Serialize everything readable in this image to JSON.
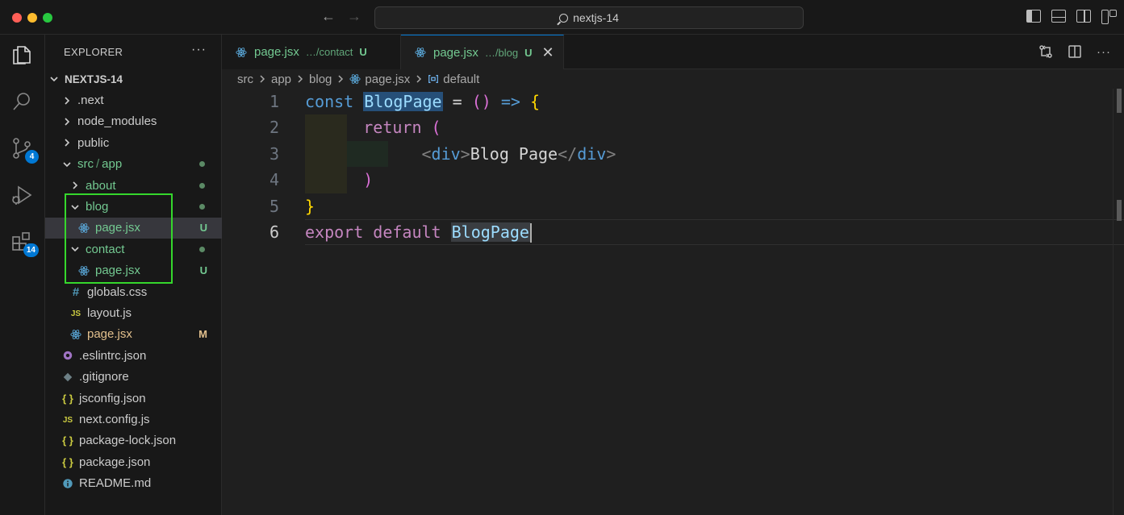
{
  "titlebar": {
    "search_text": "nextjs-14"
  },
  "activity": {
    "source_control_badge": "4",
    "extensions_badge": "14"
  },
  "explorer": {
    "title": "EXPLORER",
    "more": "···",
    "root": "NEXTJS-14",
    "items": [
      {
        "label": ".next",
        "type": "folder",
        "expanded": false,
        "indent": 1,
        "color": "default",
        "status": ""
      },
      {
        "label": "node_modules",
        "type": "folder",
        "expanded": false,
        "indent": 1,
        "color": "default",
        "status": ""
      },
      {
        "label": "public",
        "type": "folder",
        "expanded": false,
        "indent": 1,
        "color": "default",
        "status": ""
      },
      {
        "label": "src",
        "label_sep": "/",
        "label_b": "app",
        "type": "folder",
        "expanded": true,
        "indent": 1,
        "color": "green",
        "status": "dot"
      },
      {
        "label": "about",
        "type": "folder",
        "expanded": false,
        "indent": 2,
        "color": "green",
        "status": "dot"
      },
      {
        "label": "blog",
        "type": "folder",
        "expanded": true,
        "indent": 2,
        "color": "green",
        "status": "dot"
      },
      {
        "label": "page.jsx",
        "type": "react",
        "indent": 3,
        "color": "green",
        "status": "U",
        "selected": true
      },
      {
        "label": "contact",
        "type": "folder",
        "expanded": true,
        "indent": 2,
        "color": "green",
        "status": "dot"
      },
      {
        "label": "page.jsx",
        "type": "react",
        "indent": 3,
        "color": "green",
        "status": "U"
      },
      {
        "label": "globals.css",
        "type": "css",
        "indent": 2,
        "color": "default",
        "status": ""
      },
      {
        "label": "layout.js",
        "type": "js",
        "indent": 2,
        "color": "default",
        "status": ""
      },
      {
        "label": "page.jsx",
        "type": "react",
        "indent": 2,
        "color": "yellow",
        "status": "M"
      },
      {
        "label": ".eslintrc.json",
        "type": "eslint",
        "indent": 1,
        "color": "default",
        "status": ""
      },
      {
        "label": ".gitignore",
        "type": "git",
        "indent": 1,
        "color": "default",
        "status": ""
      },
      {
        "label": "jsconfig.json",
        "type": "json",
        "indent": 1,
        "color": "default",
        "status": ""
      },
      {
        "label": "next.config.js",
        "type": "js",
        "indent": 1,
        "color": "default",
        "status": ""
      },
      {
        "label": "package-lock.json",
        "type": "json",
        "indent": 1,
        "color": "default",
        "status": ""
      },
      {
        "label": "package.json",
        "type": "json",
        "indent": 1,
        "color": "default",
        "status": ""
      },
      {
        "label": "README.md",
        "type": "info",
        "indent": 1,
        "color": "default",
        "status": ""
      }
    ]
  },
  "tabs": [
    {
      "name": "page.jsx",
      "path": "…/contact",
      "status": "U"
    },
    {
      "name": "page.jsx",
      "path": "…/blog",
      "status": "U",
      "close": "✕"
    }
  ],
  "breadcrumb": {
    "parts": [
      "src",
      "app",
      "blog",
      "page.jsx",
      "default"
    ]
  },
  "code": {
    "line_numbers": [
      "1",
      "2",
      "3",
      "4",
      "5",
      "6"
    ],
    "l1": {
      "kw": "const",
      "name": "BlogPage",
      "eq": " = ",
      "paren": "()",
      "arrow": " => ",
      "brace": "{"
    },
    "l2": {
      "kw": "return",
      "paren": "("
    },
    "l3": {
      "open_lt": "<",
      "open_tag": "div",
      "open_gt": ">",
      "text": "Blog Page",
      "close_lt": "</",
      "close_tag": "div",
      "close_gt": ">"
    },
    "l4": {
      "paren": ")"
    },
    "l5": {
      "brace": "}"
    },
    "l6": {
      "kw1": "export",
      "kw2": "default",
      "name": "BlogPage"
    }
  },
  "colors": {
    "accent": "#0078d4",
    "git_untracked": "#73c991",
    "git_modified": "#e2c08d",
    "annotation_box": "#35d72c"
  }
}
